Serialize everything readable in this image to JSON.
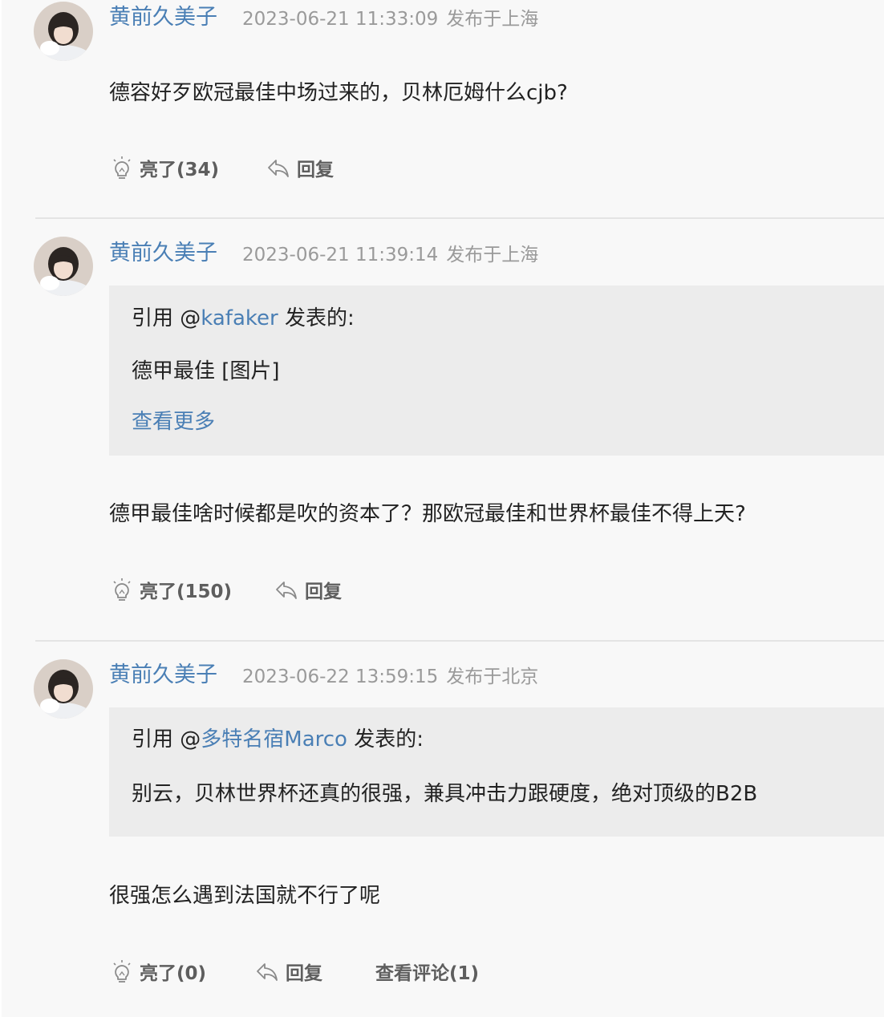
{
  "comments": [
    {
      "author": "黄前久美子",
      "time": "2023-06-21 11:33:09",
      "location": "发布于上海",
      "text": "德容好歹欧冠最佳中场过来的，贝林厄姆什么cjb?",
      "like_label": "亮了(34)",
      "reply_label": "回复"
    },
    {
      "author": "黄前久美子",
      "time": "2023-06-21 11:39:14",
      "location": "发布于上海",
      "quote": {
        "prefix": "引用 @",
        "user": "kafaker",
        "suffix": " 发表的:",
        "text": "德甲最佳 [图片]",
        "more_label": "查看更多"
      },
      "text": "德甲最佳啥时候都是吹的资本了？那欧冠最佳和世界杯最佳不得上天?",
      "like_label": "亮了(150)",
      "reply_label": "回复"
    },
    {
      "author": "黄前久美子",
      "time": "2023-06-22 13:59:15",
      "location": "发布于北京",
      "quote": {
        "prefix": "引用 @",
        "user": "多特名宿Marco",
        "suffix": " 发表的:",
        "text": "别云，贝林世界杯还真的很强，兼具冲击力跟硬度，绝对顶级的B2B"
      },
      "text": "很强怎么遇到法国就不行了呢",
      "like_label": "亮了(0)",
      "reply_label": "回复",
      "view_comments_label": "查看评论(1)"
    }
  ],
  "colors": {
    "page_bg": "#f8f8f8",
    "quote_bg": "#ececec",
    "link": "#4a7fb5",
    "meta": "#9a9a9a",
    "action": "#5e5e5e",
    "divider": "#e4e4e4"
  }
}
